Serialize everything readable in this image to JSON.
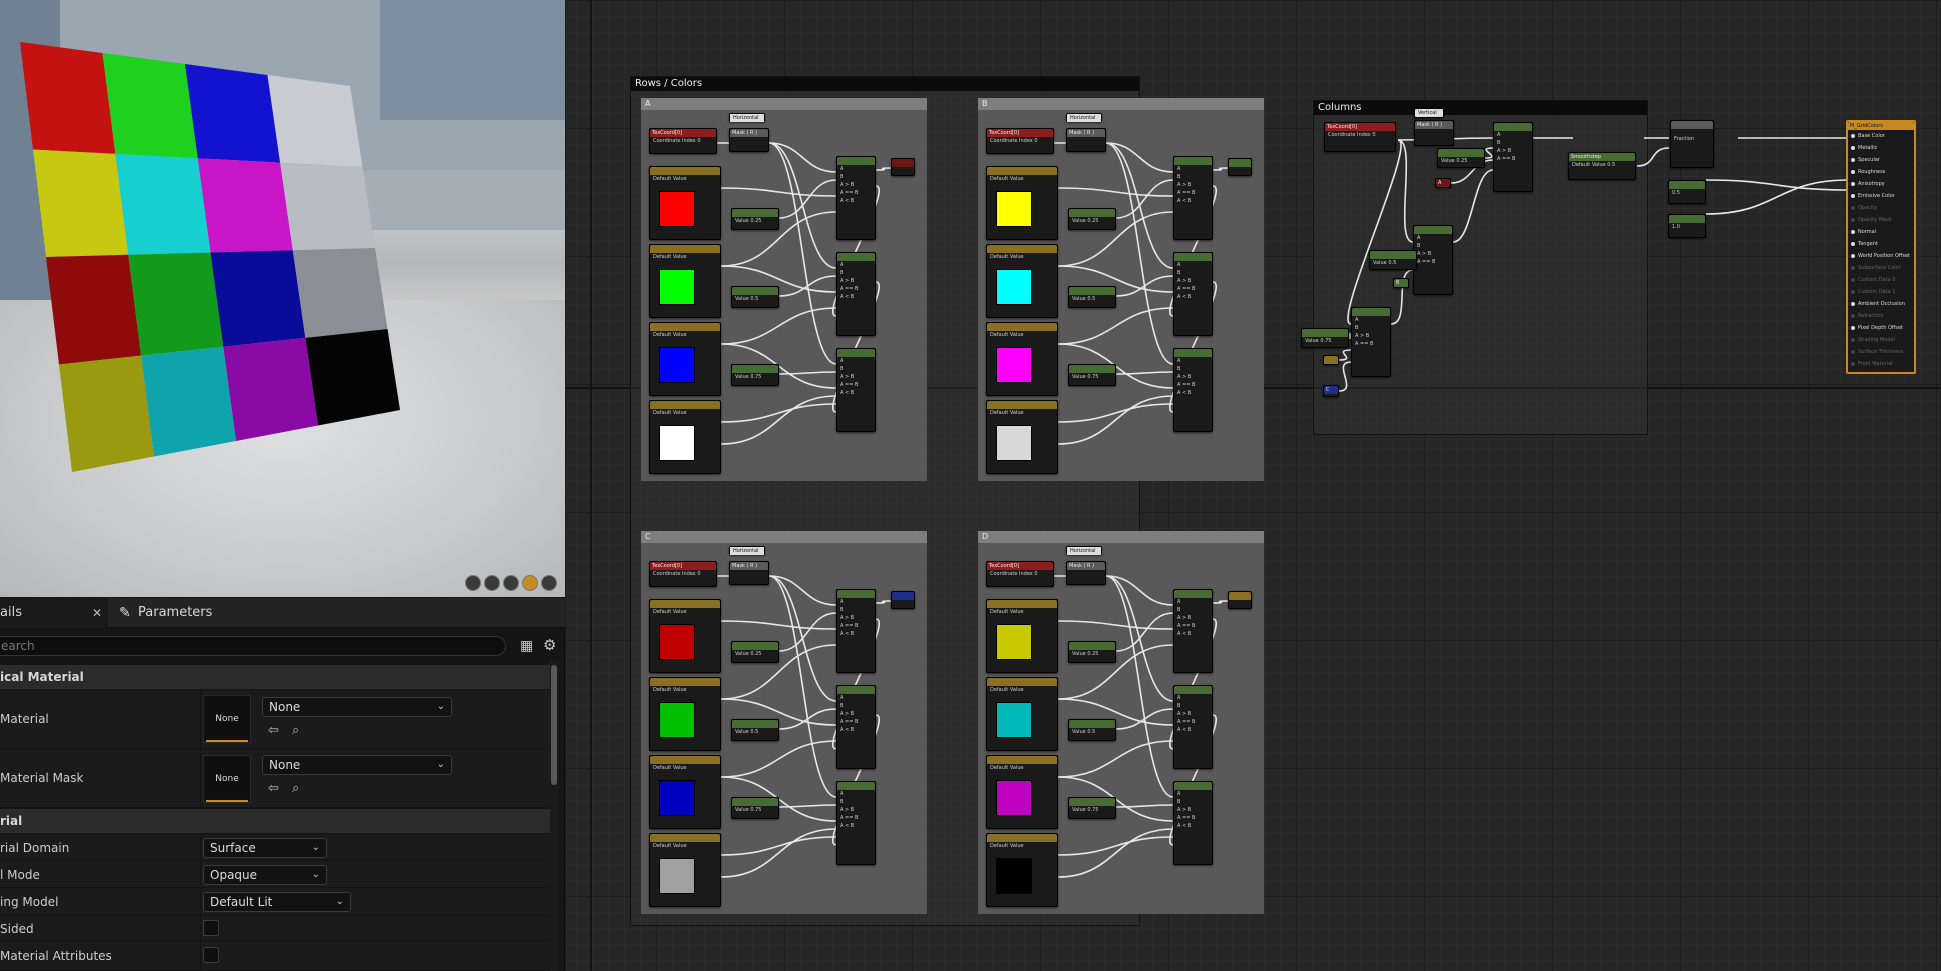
{
  "details": {
    "tab_details": "ails",
    "tab_parameters": "Parameters",
    "search_placeholder": "earch",
    "section_physical": "ical Material",
    "phys_material_label": "Material",
    "phys_material_thumb": "None",
    "phys_material_value": "None",
    "phys_mask_label": "Material Mask",
    "phys_mask_thumb": "None",
    "phys_mask_value": "None",
    "section_material": "rial",
    "domain_label": "rial Domain",
    "domain_value": "Surface",
    "blend_label": "l Mode",
    "blend_value": "Opaque",
    "shading_label": "ing Model",
    "shading_value": "Default Lit",
    "twosided_label": "Sided",
    "attrs_label": "Material Attributes"
  },
  "graph": {
    "comment_rows": "Rows / Colors",
    "comment_columns": "Columns",
    "sub_a": "A",
    "sub_b": "B",
    "sub_c": "C",
    "sub_d": "D",
    "texcoord": "TexCoord[0]",
    "coord_index": "Coordinate Index",
    "coord_index_value": "0",
    "horizontal": "Horizontal",
    "vertical": "Vertical",
    "mask_r": "Mask ( R )",
    "default_value": "Default Value",
    "value_025": "0.25",
    "value_05": "0.5",
    "value_075": "0.75",
    "value_10": "1.0",
    "luminance_default": "0.5",
    "output_name": "M_GridColors",
    "fraction": "Fraction",
    "smoothstep": "Smoothstep",
    "compare_a": "A",
    "compare_b": "B",
    "ab_gt": "A > B",
    "ab_eq": "A == B",
    "ab_lt": "A < B",
    "out_c": "C",
    "mat_pins": [
      {
        "label": "Base Color",
        "on": true
      },
      {
        "label": "Metallic",
        "on": true
      },
      {
        "label": "Specular",
        "on": true
      },
      {
        "label": "Roughness",
        "on": true
      },
      {
        "label": "Anisotropy",
        "on": true
      },
      {
        "label": "Emissive Color",
        "on": true
      },
      {
        "label": "Opacity",
        "on": false
      },
      {
        "label": "Opacity Mask",
        "on": false
      },
      {
        "label": "Normal",
        "on": true
      },
      {
        "label": "Tangent",
        "on": true
      },
      {
        "label": "World Position Offset",
        "on": true
      },
      {
        "label": "Subsurface Color",
        "on": false
      },
      {
        "label": "Custom Data 0",
        "on": false
      },
      {
        "label": "Custom Data 1",
        "on": false
      },
      {
        "label": "Ambient Occlusion",
        "on": true
      },
      {
        "label": "Refraction",
        "on": false
      },
      {
        "label": "Pixel Depth Offset",
        "on": true
      },
      {
        "label": "Shading Model",
        "on": false
      },
      {
        "label": "Surface Thickness",
        "on": false
      },
      {
        "label": "Front Material",
        "on": false
      }
    ]
  },
  "viewport": {
    "grid_colors": [
      [
        "#c3120f",
        "#1ed11e",
        "#1212cf",
        "#c8ccd2"
      ],
      [
        "#c6c811",
        "#16cfcf",
        "#c815c8",
        "#b8bcc3"
      ],
      [
        "#8f0b0b",
        "#129b1a",
        "#0b0b9a",
        "#8a8e95"
      ],
      [
        "#9a9a10",
        "#0fa3ac",
        "#8a0aa6",
        "#050505"
      ]
    ]
  },
  "colors": {
    "accent": "#c78a22",
    "panel_bg": "#1b1b1b",
    "graph_bg": "#262626"
  }
}
